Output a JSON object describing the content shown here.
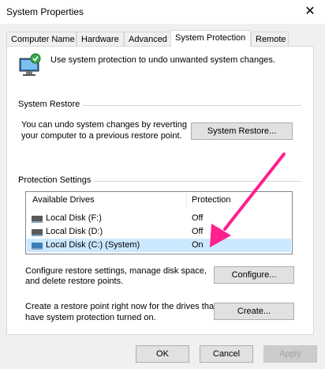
{
  "window": {
    "title": "System Properties",
    "close_glyph": "✕"
  },
  "tabs": [
    {
      "label": "Computer Name"
    },
    {
      "label": "Hardware"
    },
    {
      "label": "Advanced"
    },
    {
      "label": "System Protection"
    },
    {
      "label": "Remote"
    }
  ],
  "intro": {
    "text": "Use system protection to undo unwanted system changes."
  },
  "system_restore": {
    "heading": "System Restore",
    "description_line1": "You can undo system changes by reverting",
    "description_line2": "your computer to a previous restore point.",
    "button_label": "System Restore..."
  },
  "protection": {
    "heading": "Protection Settings",
    "columns": [
      "Available Drives",
      "Protection"
    ],
    "drives": [
      {
        "name": "Local Disk (F:)",
        "protection": "Off"
      },
      {
        "name": "Local Disk (D:)",
        "protection": "Off"
      },
      {
        "name": "Local Disk (C:) (System)",
        "protection": "On"
      }
    ],
    "configure_line1": "Configure restore settings, manage disk space,",
    "configure_line2": "and delete restore points.",
    "configure_label": "Configure...",
    "create_line1": "Create a restore point right now for the drives that",
    "create_line2": "have system protection turned on.",
    "create_label": "Create..."
  },
  "footer": {
    "ok_label": "OK",
    "cancel_label": "Cancel",
    "apply_label": "Apply"
  },
  "colors": {
    "annotation_arrow": "#ff1f8e",
    "selection": "#cce8ff"
  }
}
